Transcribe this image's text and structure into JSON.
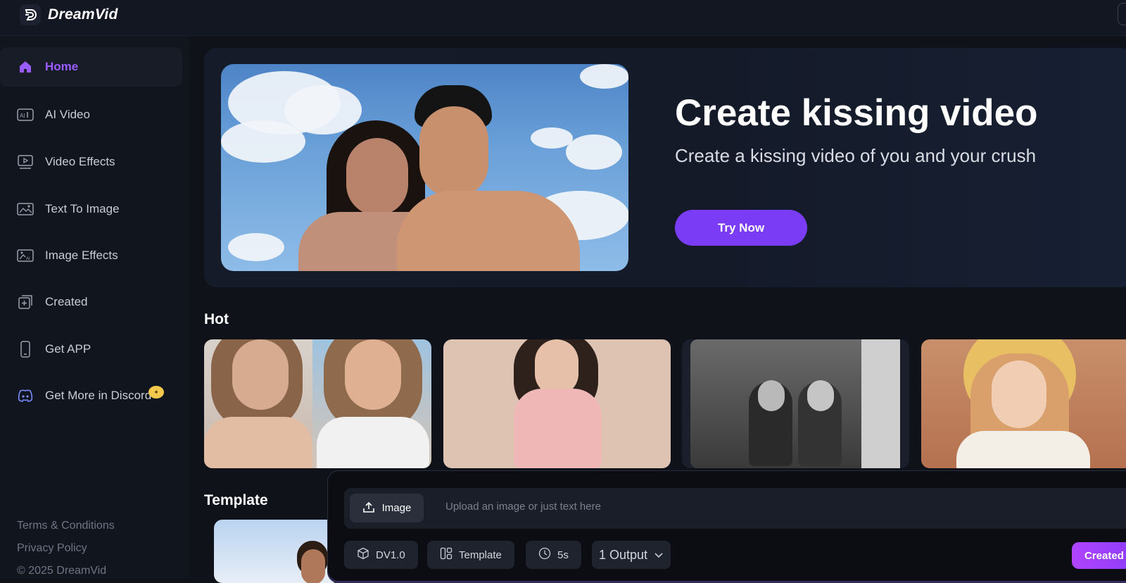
{
  "app": {
    "brand_name": "DreamVid"
  },
  "sidebar": {
    "items": [
      {
        "label": "Home",
        "icon": "home-icon",
        "active": true
      },
      {
        "label": "AI Video",
        "icon": "ai-video-icon"
      },
      {
        "label": "Video Effects",
        "icon": "video-effects-icon"
      },
      {
        "label": "Text To Image",
        "icon": "text-to-image-icon"
      },
      {
        "label": "Image Effects",
        "icon": "image-effects-icon"
      },
      {
        "label": "Created",
        "icon": "created-icon"
      },
      {
        "label": "Get APP",
        "icon": "phone-icon"
      },
      {
        "label": "Get More in Discord",
        "icon": "discord-icon",
        "badge": "✦"
      }
    ],
    "footer": {
      "terms": "Terms & Conditions",
      "privacy": "Privacy Policy",
      "copyright": "© 2025 DreamVid"
    }
  },
  "hero": {
    "title": "Create kissing video",
    "subtitle": "Create a kissing video of you and your crush",
    "cta": "Try Now"
  },
  "sections": {
    "hot": "Hot",
    "template": "Template"
  },
  "composer": {
    "upload_label": "Image",
    "placeholder": "Upload an image or just text here",
    "model": "DV1.0",
    "template": "Template",
    "duration": "5s",
    "outputs": "1 Output",
    "submit": "Created"
  },
  "colors": {
    "accent": "#7b3cf5",
    "active_nav": "#9b5cff",
    "background": "#0f1219"
  }
}
